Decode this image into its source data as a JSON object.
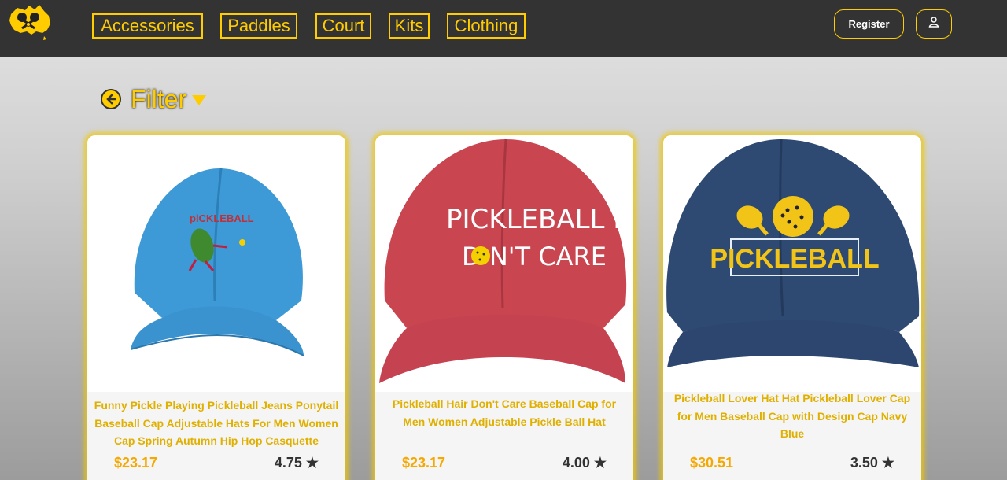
{
  "nav": {
    "items": [
      {
        "label": "Accessories"
      },
      {
        "label": "Paddles"
      },
      {
        "label": "Court"
      },
      {
        "label": "Kits"
      },
      {
        "label": "Clothing"
      }
    ],
    "register_label": "Register",
    "user_icon": "user-icon",
    "logo_icon": "australia-pickleball-logo-icon"
  },
  "filter": {
    "label": "Filter",
    "icon": "circle-arrow-icon",
    "caret_icon": "caret-down-icon"
  },
  "colors": {
    "accent": "#ffcc00",
    "topbar": "#333333",
    "price": "#f5a800"
  },
  "products": [
    {
      "title": "Funny Pickle Playing Pickleball Jeans Ponytail Baseball Cap Adjustable Hats For Men Women Cap Spring Autumn Hip Hop Casquette",
      "price": "$23.17",
      "rating": "4.75 ★",
      "image": "blue-pickle-cap-image"
    },
    {
      "title": "Pickleball Hair Don't Care Baseball Cap for Men Women Adjustable Pickle Ball Hat",
      "price": "$23.17",
      "rating": "4.00 ★",
      "image": "red-pickleball-hair-cap-image",
      "cap_text_line1": "PICKLEBALL HAIR",
      "cap_text_line2": "D  N'T CARE"
    },
    {
      "title": "Pickleball Lover Hat Hat Pickleball Lover Cap for Men Baseball Cap with Design Cap Navy Blue",
      "price": "$30.51",
      "rating": "3.50 ★",
      "image": "navy-pickleball-cap-image",
      "cap_text": "PICKLEBALL"
    }
  ]
}
